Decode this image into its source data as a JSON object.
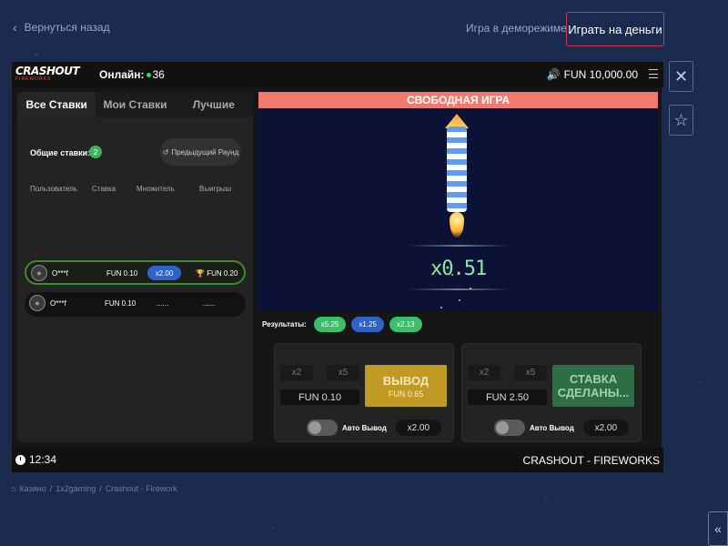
{
  "header": {
    "back_label": "Вернуться назад",
    "demo_label": "Игра в деморежиме",
    "real_money_label": "Играть на деньги"
  },
  "side": {
    "close_icon": "close-icon",
    "favorite_icon": "star-icon"
  },
  "game": {
    "logo_main": "CRASHOUT",
    "logo_sub": "FIREWORKS",
    "online_label": "Онлайн:",
    "online_count": "36",
    "balance": "FUN 10,000.00",
    "tabs": [
      {
        "label": "Все Ставки",
        "active": true
      },
      {
        "label": "Мои Ставки",
        "active": false
      },
      {
        "label": "Лучшие",
        "active": false
      }
    ],
    "total_bets_label": "Общие ставки:",
    "total_bets_count": "2",
    "prev_round_label": "Предыдущий Раунд",
    "columns": {
      "user": "Пользователь",
      "stake": "Ставка",
      "multiplier": "Множитель",
      "winnings": "Выигрыш"
    },
    "bets": [
      {
        "user": "O***f",
        "stake": "FUN 0.10",
        "multiplier": "x2.00",
        "winnings": "FUN 0.20",
        "won": true
      },
      {
        "user": "O***f",
        "stake": "FUN 0.10",
        "multiplier": "......",
        "winnings": "......",
        "won": false
      }
    ],
    "banner": "СВОБОДНАЯ ИГРА",
    "current_multiplier": "x0.51",
    "results_label": "Результаты:",
    "results": [
      {
        "value": "x5.25",
        "color": "#3bbf6a"
      },
      {
        "value": "x1.25",
        "color": "#2d63c9"
      },
      {
        "value": "x2.13",
        "color": "#3bbf6a"
      }
    ],
    "bet_panels": [
      {
        "quick1": "x2",
        "quick2": "x5",
        "amount": "FUN 0.10",
        "action": "ВЫВОД",
        "action_sub": "FUN 0.65",
        "auto_label": "Авто Вывод",
        "auto_value": "x2.00"
      },
      {
        "quick1": "x2",
        "quick2": "x5",
        "amount": "FUN 2.50",
        "action": "СТАВКА СДЕЛАНЫ...",
        "action_sub": "",
        "auto_label": "Авто Вывод",
        "auto_value": "x2.00"
      }
    ],
    "time": "12:34",
    "game_name": "CRASHOUT - FIREWORKS"
  },
  "breadcrumb": [
    "Казино",
    "1x2gaming",
    "Crashout - Firework"
  ],
  "colors": {
    "accent_red": "#d2334a",
    "cashout_gold": "#c09a25",
    "placed_green": "#2e6e45",
    "banner": "#f07a72"
  }
}
